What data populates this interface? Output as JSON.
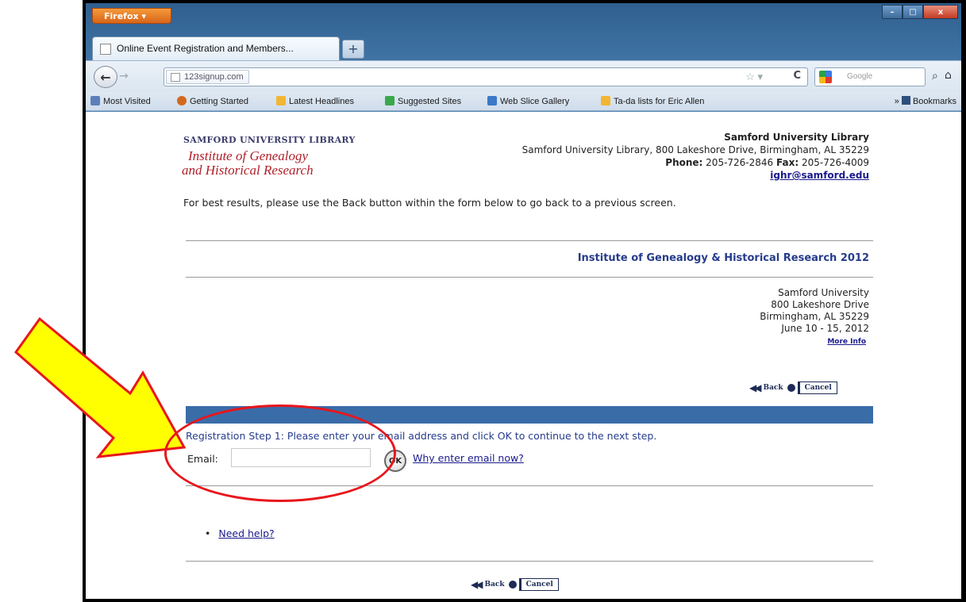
{
  "browser": {
    "menu_label": "Firefox",
    "tab_title": "Online Event Registration and Members...",
    "new_tab_label": "+",
    "url": "123signup.com",
    "search_placeholder": "Google",
    "window_controls": {
      "minimize": "–",
      "maximize": "□",
      "close": "x"
    }
  },
  "bookmarks": {
    "items": [
      {
        "label": "Most Visited",
        "icon_color": "#5b7fb8"
      },
      {
        "label": "Getting Started",
        "icon_color": "#d2691e"
      },
      {
        "label": "Latest Headlines",
        "icon_color": "#f2b632"
      },
      {
        "label": "Suggested Sites",
        "icon_color": "#3aa84a"
      },
      {
        "label": "Web Slice Gallery",
        "icon_color": "#3a78c8"
      },
      {
        "label": "Ta-da lists for Eric Allen",
        "icon_color": "#f2b632"
      }
    ],
    "overflow_label": "» ",
    "bookmarks_label": "Bookmarks"
  },
  "page": {
    "logo": {
      "line1": "SAMFORD UNIVERSITY LIBRARY",
      "line2": "Institute of Genealogy",
      "line3": "and Historical Research"
    },
    "org": {
      "name": "Samford University Library",
      "address": "Samford University Library, 800 Lakeshore Drive, Birmingham, AL 35229",
      "phone_label": "Phone:",
      "phone": "205-726-2846",
      "fax_label": "Fax:",
      "fax": "205-726-4009",
      "email": "ighr@samford.edu"
    },
    "best_results": "For best results, please use the Back button within the form below to go back to a previous screen.",
    "event_title": "Institute of Genealogy & Historical Research 2012",
    "venue": {
      "line1": "Samford University",
      "line2": "800 Lakeshore Drive",
      "line3": "Birmingham, AL 35229",
      "dates": "June 10 - 15, 2012",
      "more_info": "More Info"
    },
    "nav": {
      "back": "Back",
      "cancel": "Cancel"
    },
    "step_text": "Registration Step 1: Please enter your email address and click OK to continue to the next step.",
    "email_label": "Email:",
    "email_value": "",
    "ok_label": "OK",
    "why_link": "Why enter email now?",
    "need_help": "Need help?"
  },
  "colors": {
    "accent_blue": "#3a6ca8",
    "link_blue": "#1a1a8c",
    "annotation_red": "#e8161c",
    "annotation_yellow": "#ffff00"
  }
}
